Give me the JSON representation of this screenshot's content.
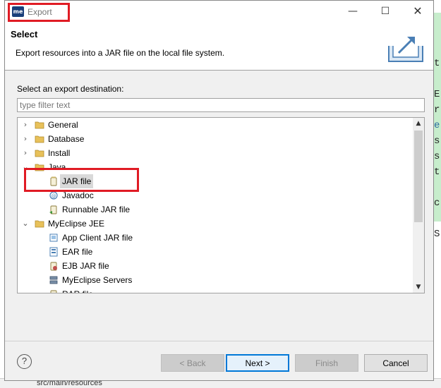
{
  "window": {
    "title": "Export",
    "app_icon_text": "me",
    "minimize_glyph": "—",
    "maximize_glyph": "☐",
    "close_glyph": "✕"
  },
  "header": {
    "title": "Select",
    "description": "Export resources into a JAR file on the local file system."
  },
  "destination": {
    "label": "Select an export destination:",
    "filter_placeholder": "type filter text",
    "filter_value": ""
  },
  "tree": {
    "items": [
      {
        "label": "General",
        "icon": "folder-icon",
        "expanded": false
      },
      {
        "label": "Database",
        "icon": "folder-icon",
        "expanded": false
      },
      {
        "label": "Install",
        "icon": "folder-icon",
        "expanded": false
      },
      {
        "label": "Java",
        "icon": "folder-icon",
        "expanded": true
      },
      {
        "label": "JAR file",
        "icon": "jar-icon",
        "selected": true
      },
      {
        "label": "Javadoc",
        "icon": "javadoc-icon"
      },
      {
        "label": "Runnable JAR file",
        "icon": "runnable-jar-icon"
      },
      {
        "label": "MyEclipse JEE",
        "icon": "folder-icon",
        "expanded": true
      },
      {
        "label": "App Client JAR file",
        "icon": "app-client-jar-icon"
      },
      {
        "label": "EAR file",
        "icon": "ear-icon"
      },
      {
        "label": "EJB JAR file",
        "icon": "ejb-jar-icon"
      },
      {
        "label": "MyEclipse Servers",
        "icon": "servers-icon"
      },
      {
        "label": "RAR file",
        "icon": "rar-icon"
      }
    ]
  },
  "buttons": {
    "back": "< Back",
    "next": "Next >",
    "finish": "Finish",
    "cancel": "Cancel",
    "help": "?"
  },
  "background": {
    "right_chars": [
      "t",
      "E",
      "r",
      "e",
      "s",
      "s",
      "t",
      "c",
      "S"
    ],
    "bottom_text": "src/main/resources"
  },
  "colors": {
    "highlight_box": "#e01b24",
    "primary_button_border": "#0078d7",
    "folder_yellow": "#e8c15a",
    "editor_green": "#c7edcc"
  }
}
